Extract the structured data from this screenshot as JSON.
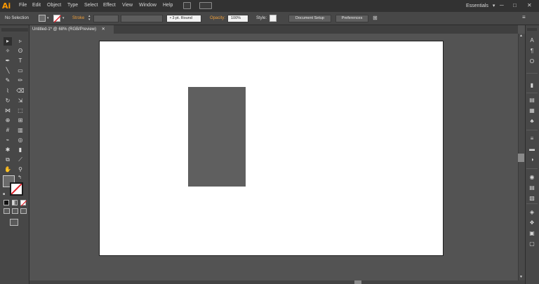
{
  "app": {
    "logo": "Ai"
  },
  "menu": [
    "File",
    "Edit",
    "Object",
    "Type",
    "Select",
    "Effect",
    "View",
    "Window",
    "Help"
  ],
  "workspace": {
    "label": "Essentials",
    "arrow": "▾"
  },
  "window_controls": [
    "─",
    "□",
    "✕"
  ],
  "control_bar": {
    "selection_label": "No Selection",
    "stroke_label": "Stroke",
    "brush_label": "3 pt. Round",
    "opacity_label": "Opacity:",
    "opacity_value": "100%",
    "style_label": "Style:",
    "document_setup": "Document Setup",
    "preferences": "Preferences"
  },
  "document_tab": {
    "title": "Untitled-1* @ 68% (RGB/Preview)",
    "close": "✕"
  },
  "colors": {
    "fill": "#6b6b6b",
    "stroke": "none",
    "rectangle_fill": "#5f5f5f",
    "accent": "#ff9a00"
  },
  "tools": [
    [
      "selection-tool",
      "▸"
    ],
    [
      "direct-selection-tool",
      "▹"
    ],
    [
      "magic-wand-tool",
      "✧"
    ],
    [
      "lasso-tool",
      "ʘ"
    ],
    [
      "pen-tool",
      "✒"
    ],
    [
      "type-tool",
      "T"
    ],
    [
      "line-segment-tool",
      "╲"
    ],
    [
      "rectangle-tool",
      "▭"
    ],
    [
      "paintbrush-tool",
      "✎"
    ],
    [
      "pencil-tool",
      "✏"
    ],
    [
      "blob-brush-tool",
      "⌇"
    ],
    [
      "eraser-tool",
      "⌫"
    ],
    [
      "rotate-tool",
      "↻"
    ],
    [
      "scale-tool",
      "⇲"
    ],
    [
      "width-tool",
      "⋈"
    ],
    [
      "free-transform-tool",
      "⬚"
    ],
    [
      "shape-builder-tool",
      "⊕"
    ],
    [
      "perspective-grid-tool",
      "⊞"
    ],
    [
      "mesh-tool",
      "#"
    ],
    [
      "gradient-tool",
      "▥"
    ],
    [
      "eyedropper-tool",
      "⌁"
    ],
    [
      "blend-tool",
      "◎"
    ],
    [
      "symbol-sprayer-tool",
      "✱"
    ],
    [
      "column-graph-tool",
      "▮"
    ],
    [
      "artboard-tool",
      "⧉"
    ],
    [
      "slice-tool",
      "⟋"
    ],
    [
      "hand-tool",
      "✋"
    ],
    [
      "zoom-tool",
      "⚲"
    ]
  ],
  "dock_icons": [
    "A",
    "¶",
    "O",
    "▮",
    "▤",
    "▦",
    "♣",
    "≡",
    "▬",
    "◑",
    "◉",
    "▤",
    "▧",
    "◈",
    "❖",
    "▣",
    "▢"
  ]
}
